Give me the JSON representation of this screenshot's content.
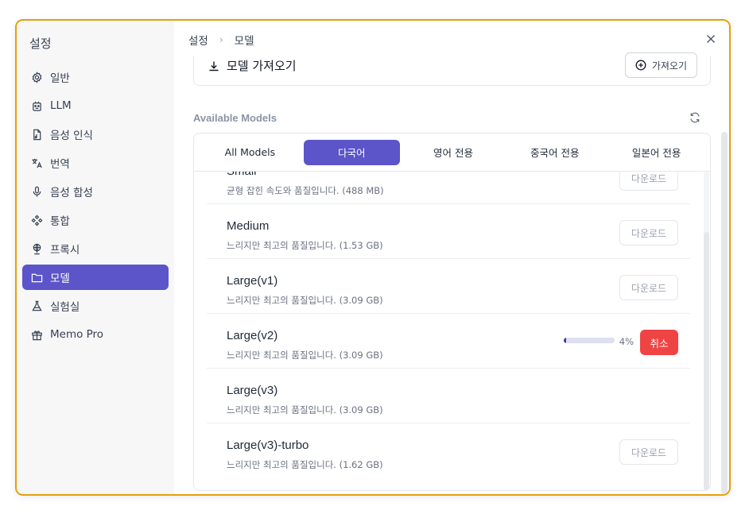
{
  "sidebar": {
    "title": "설정",
    "items": [
      {
        "label": "일반",
        "icon": "gear-icon"
      },
      {
        "label": "LLM",
        "icon": "robot-icon"
      },
      {
        "label": "음성 인식",
        "icon": "audio-file-icon"
      },
      {
        "label": "번역",
        "icon": "translate-icon"
      },
      {
        "label": "음성 합성",
        "icon": "microphone-icon"
      },
      {
        "label": "통합",
        "icon": "integration-icon"
      },
      {
        "label": "프록시",
        "icon": "globe-icon"
      },
      {
        "label": "모델",
        "icon": "folder-icon",
        "active": true
      },
      {
        "label": "실험실",
        "icon": "experiment-icon"
      },
      {
        "label": "Memo Pro",
        "icon": "gift-icon"
      }
    ]
  },
  "header": {
    "breadcrumb": [
      "설정",
      "모델"
    ],
    "breadcrumb_separator": "›"
  },
  "import_section": {
    "title": "모델 가져오기",
    "button_label": "가져오기"
  },
  "models": {
    "section_label": "Available Models",
    "tabs": [
      {
        "label": "All Models"
      },
      {
        "label": "다국어",
        "active": true
      },
      {
        "label": "영어 전용"
      },
      {
        "label": "중국어 전용"
      },
      {
        "label": "일본어 전용"
      }
    ],
    "rows": [
      {
        "name": "Small",
        "desc": "균형 잡힌 속도와 품질입니다. (488 MB)",
        "action": "download",
        "button_label": "다운로드"
      },
      {
        "name": "Medium",
        "desc": "느리지만 최고의 품질입니다. (1.53 GB)",
        "action": "download",
        "button_label": "다운로드"
      },
      {
        "name": "Large(v1)",
        "desc": "느리지만 최고의 품질입니다. (3.09 GB)",
        "action": "download",
        "button_label": "다운로드"
      },
      {
        "name": "Large(v2)",
        "desc": "느리지만 최고의 품질입니다. (3.09 GB)",
        "action": "downloading",
        "progress_text": "4%",
        "progress_value": 0.04,
        "button_label": "취소"
      },
      {
        "name": "Large(v3)",
        "desc": "느리지만 최고의 품질입니다. (3.09 GB)",
        "action": "none"
      },
      {
        "name": "Large(v3)-turbo",
        "desc": "느리지만 최고의 품질입니다. (1.62 GB)",
        "action": "download",
        "button_label": "다운로드"
      }
    ]
  },
  "colors": {
    "accent": "#5b55c9",
    "danger": "#ef4444",
    "window_border": "#e5a00d"
  }
}
